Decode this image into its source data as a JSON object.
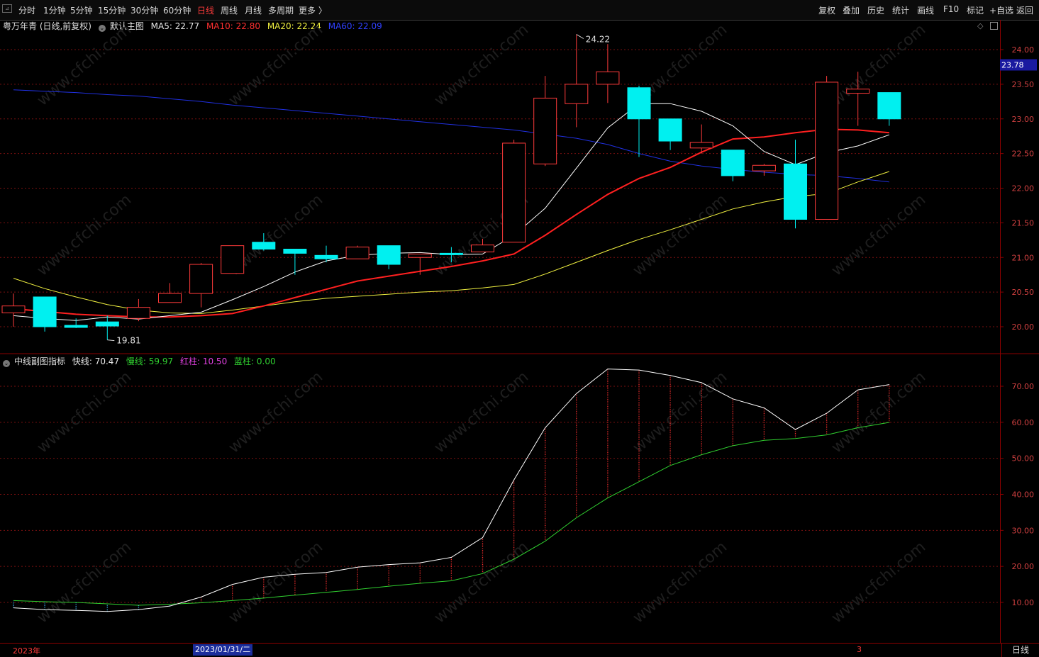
{
  "toolbar": {
    "periods": [
      "分时",
      "1分钟",
      "5分钟",
      "15分钟",
      "30分钟",
      "60分钟",
      "日线",
      "周线",
      "月线",
      "多周期",
      "更多 〉"
    ],
    "active_index": 6,
    "right_buttons": [
      "复权",
      "叠加",
      "历史",
      "统计",
      "画线",
      "F10",
      "标记",
      "+自选",
      "返回"
    ]
  },
  "main_legend": {
    "stock": "粤万年青 (日线,前复权)",
    "template": "默认主图",
    "ma5_label": "MA5:",
    "ma5": "22.77",
    "ma10_label": "MA10:",
    "ma10": "22.80",
    "ma20_label": "MA20:",
    "ma20": "22.24",
    "ma60_label": "MA60:",
    "ma60": "22.09"
  },
  "sub_legend": {
    "name": "中线副图指标",
    "fast_label": "快线:",
    "fast": "70.47",
    "slow_label": "慢线:",
    "slow": "59.97",
    "red_label": "红柱:",
    "red": "10.50",
    "blue_label": "蓝柱:",
    "blue": "0.00"
  },
  "colors": {
    "up": "#ff3b3b",
    "down": "#00f0f0",
    "ma5": "#ffffff",
    "ma10": "#ff2020",
    "ma20": "#f0f040",
    "ma60": "#2030e0",
    "fast": "#ffffff",
    "slow": "#30d030"
  },
  "current_price_tag": "23.78",
  "high_label": "24.22",
  "low_label": "19.81",
  "price_axis": [
    "24.00",
    "23.50",
    "23.00",
    "22.50",
    "22.00",
    "21.50",
    "21.00",
    "20.50",
    "20.00"
  ],
  "sub_axis": [
    "70.00",
    "60.00",
    "50.00",
    "40.00",
    "30.00",
    "20.00",
    "10.00"
  ],
  "bottom": {
    "year_label": "2023年",
    "cursor_date": "2023/01/31/二",
    "month_label": "3",
    "period_label": "日线"
  },
  "chart_data": [
    {
      "type": "candlestick",
      "ylim": [
        19.55,
        24.45
      ],
      "candles": [
        {
          "o": 20.2,
          "h": 20.48,
          "l": 20.0,
          "c": 20.3
        },
        {
          "o": 20.43,
          "h": 20.43,
          "l": 19.93,
          "c": 20.0
        },
        {
          "o": 20.02,
          "h": 20.12,
          "l": 19.98,
          "c": 19.99
        },
        {
          "o": 20.07,
          "h": 20.16,
          "l": 19.81,
          "c": 20.01
        },
        {
          "o": 20.12,
          "h": 20.4,
          "l": 20.08,
          "c": 20.28
        },
        {
          "o": 20.35,
          "h": 20.63,
          "l": 20.35,
          "c": 20.48
        },
        {
          "o": 20.48,
          "h": 20.92,
          "l": 20.28,
          "c": 20.9
        },
        {
          "o": 20.77,
          "h": 21.17,
          "l": 20.77,
          "c": 21.17
        },
        {
          "o": 21.22,
          "h": 21.35,
          "l": 21.1,
          "c": 21.12
        },
        {
          "o": 21.12,
          "h": 21.12,
          "l": 20.75,
          "c": 21.06
        },
        {
          "o": 21.03,
          "h": 21.17,
          "l": 20.93,
          "c": 20.98
        },
        {
          "o": 20.98,
          "h": 21.17,
          "l": 20.98,
          "c": 21.15
        },
        {
          "o": 21.17,
          "h": 21.17,
          "l": 20.83,
          "c": 20.9
        },
        {
          "o": 21.0,
          "h": 21.05,
          "l": 20.75,
          "c": 21.05
        },
        {
          "o": 21.06,
          "h": 21.15,
          "l": 20.93,
          "c": 21.04
        },
        {
          "o": 21.08,
          "h": 21.27,
          "l": 21.08,
          "c": 21.18
        },
        {
          "o": 21.22,
          "h": 22.7,
          "l": 21.22,
          "c": 22.65
        },
        {
          "o": 22.35,
          "h": 23.62,
          "l": 22.32,
          "c": 23.3
        },
        {
          "o": 23.22,
          "h": 24.22,
          "l": 22.88,
          "c": 23.5
        },
        {
          "o": 23.5,
          "h": 24.08,
          "l": 23.23,
          "c": 23.68
        },
        {
          "o": 23.45,
          "h": 23.48,
          "l": 22.45,
          "c": 23.0
        },
        {
          "o": 23.0,
          "h": 23.0,
          "l": 22.55,
          "c": 22.68
        },
        {
          "o": 22.58,
          "h": 22.92,
          "l": 22.5,
          "c": 22.66
        },
        {
          "o": 22.55,
          "h": 22.55,
          "l": 22.1,
          "c": 22.18
        },
        {
          "o": 22.25,
          "h": 22.35,
          "l": 22.18,
          "c": 22.33
        },
        {
          "o": 22.35,
          "h": 22.7,
          "l": 21.42,
          "c": 21.55
        },
        {
          "o": 21.55,
          "h": 23.62,
          "l": 21.55,
          "c": 23.53
        },
        {
          "o": 23.37,
          "h": 23.68,
          "l": 22.9,
          "c": 23.43
        },
        {
          "o": 23.38,
          "h": 23.38,
          "l": 22.9,
          "c": 23.0
        }
      ],
      "ma5": [
        20.16,
        20.12,
        20.09,
        20.14,
        20.11,
        20.16,
        20.21,
        20.39,
        20.58,
        20.79,
        20.95,
        21.03,
        21.06,
        21.07,
        21.04,
        21.05,
        21.32,
        21.71,
        22.29,
        22.87,
        23.22,
        23.22,
        23.11,
        22.9,
        22.53,
        22.34,
        22.51,
        22.61,
        22.77
      ],
      "ma10": [
        20.26,
        20.22,
        20.18,
        20.16,
        20.14,
        20.14,
        20.16,
        20.19,
        20.3,
        20.42,
        20.54,
        20.66,
        20.73,
        20.8,
        20.87,
        20.95,
        21.05,
        21.32,
        21.62,
        21.91,
        22.14,
        22.3,
        22.52,
        22.71,
        22.74,
        22.8,
        22.85,
        22.84,
        22.8
      ],
      "ma20": [
        20.7,
        20.55,
        20.43,
        20.32,
        20.24,
        20.2,
        20.19,
        20.24,
        20.3,
        20.36,
        20.41,
        20.44,
        20.47,
        20.5,
        20.52,
        20.56,
        20.61,
        20.76,
        20.93,
        21.1,
        21.26,
        21.4,
        21.55,
        21.7,
        21.8,
        21.88,
        21.92,
        22.09,
        22.24
      ],
      "ma60": [
        23.42,
        23.4,
        23.38,
        23.35,
        23.33,
        23.29,
        23.25,
        23.2,
        23.16,
        23.12,
        23.08,
        23.04,
        23.0,
        22.96,
        22.92,
        22.88,
        22.84,
        22.78,
        22.72,
        22.63,
        22.5,
        22.39,
        22.32,
        22.27,
        22.23,
        22.2,
        22.18,
        22.14,
        22.09
      ]
    },
    {
      "type": "line",
      "name": "中线副图指标",
      "ylim": [
        1,
        78
      ],
      "fast": [
        8.5,
        8.0,
        7.8,
        7.5,
        8.0,
        9.0,
        11.5,
        15.0,
        17.0,
        17.8,
        18.3,
        19.8,
        20.5,
        21.0,
        22.5,
        28.0,
        44.0,
        58.5,
        68.0,
        74.8,
        74.5,
        73.0,
        71.0,
        66.5,
        64.0,
        58.0,
        62.5,
        69.0,
        70.47
      ],
      "slow": [
        10.5,
        10.2,
        10.0,
        9.6,
        9.2,
        9.5,
        9.9,
        10.5,
        11.2,
        12.0,
        12.8,
        13.6,
        14.5,
        15.3,
        16.0,
        18.0,
        22.0,
        27.0,
        33.5,
        39.0,
        43.5,
        48.0,
        51.0,
        53.5,
        55.0,
        55.5,
        56.5,
        58.5,
        59.97
      ]
    }
  ]
}
